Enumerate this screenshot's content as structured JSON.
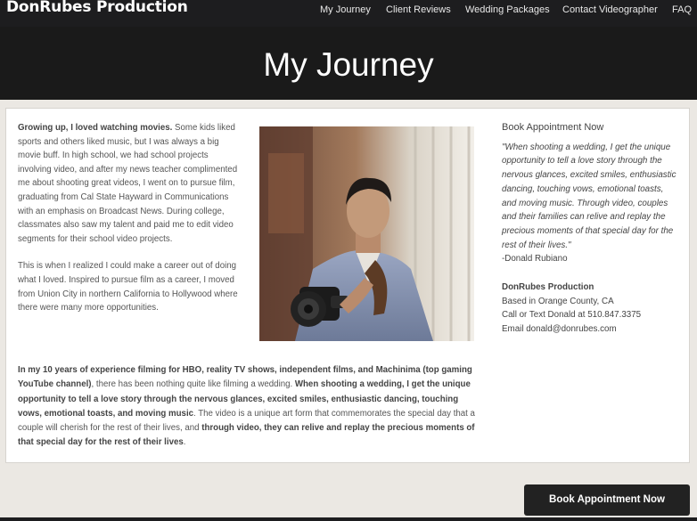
{
  "header": {
    "brand": "DonRubes Production",
    "nav": [
      "My Journey",
      "Client Reviews",
      "Wedding Packages",
      "Contact Videographer",
      "FAQ"
    ]
  },
  "hero": {
    "title": "My Journey"
  },
  "content": {
    "p1_bold": "Growing up, I loved watching movies.",
    "p1_text": "  Some kids liked sports and others liked music, but I was always a big movie buff.  In high school, we had school projects involving video, and after my news teacher complimented me about shooting great videos, I went on to pursue film, graduating from Cal State Hayward in Communications with an emphasis on Broadcast News.  During college, classmates also saw my talent and paid me to edit video segments for their school video projects.",
    "p2": "This is when I realized I could make a career out of doing what I loved. Inspired to pursue film as a career, I moved from Union City in northern California to Hollywood where there were many more opportunities.",
    "p3_bold1": "In my 10 years of experience filming for HBO, reality TV shows, independent films, and Machinima (top gaming YouTube channel)",
    "p3_text1": ", there has been nothing quite like filming a wedding.  ",
    "p3_bold2": "When shooting a wedding, I get the unique opportunity to tell a love story through the nervous glances, excited smiles, enthusiastic dancing, touching vows, emotional toasts, and moving music",
    "p3_text2": ".  The video is a unique art form that commemorates the special day that a couple will cherish for the rest of their lives, and ",
    "p3_bold3": "through video, they can relive and replay the precious moments of that special day for the rest of their lives",
    "p3_text3": "."
  },
  "sidebar": {
    "title": "Book Appointment Now",
    "quote": "\"When shooting a wedding, I get the unique opportunity to tell a love story through the nervous glances, excited smiles, enthusiastic dancing, touching vows, emotional toasts, and moving music. Through video, couples and their families can relive and replay the precious moments of that special day for the rest of their lives.\"",
    "signature": "-Donald Rubiano",
    "company": "DonRubes Production",
    "location": "Based in Orange County, CA",
    "phone": "Call or Text Donald at 510.847.3375",
    "email": "Email donald@donrubes.com"
  },
  "cta": {
    "label": "Book Appointment Now"
  }
}
